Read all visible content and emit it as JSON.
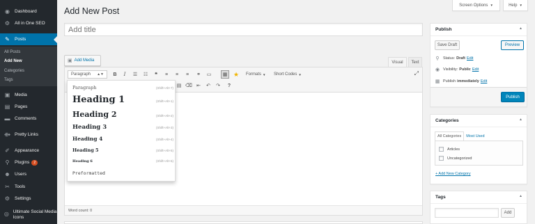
{
  "sidebar": {
    "items": [
      {
        "label": "Dashboard",
        "icon": "dashboard-icon",
        "glyph": "◉"
      },
      {
        "label": "All in One SEO",
        "icon": "seo-gear-icon",
        "glyph": "⚙"
      },
      {
        "label": "Posts",
        "icon": "pushpin-icon",
        "glyph": "✎"
      },
      {
        "label": "Media",
        "icon": "media-icon",
        "glyph": "▣"
      },
      {
        "label": "Pages",
        "icon": "pages-icon",
        "glyph": "▤"
      },
      {
        "label": "Comments",
        "icon": "comment-icon",
        "glyph": "▬"
      },
      {
        "label": "Pretty Links",
        "icon": "pretty-links-icon",
        "glyph": "⟴"
      },
      {
        "label": "Appearance",
        "icon": "appearance-brush-icon",
        "glyph": "✐"
      },
      {
        "label": "Plugins",
        "icon": "plugins-icon",
        "glyph": "⚲",
        "badge": "2"
      },
      {
        "label": "Users",
        "icon": "users-icon",
        "glyph": "☻"
      },
      {
        "label": "Tools",
        "icon": "tools-wrench-icon",
        "glyph": "✂"
      },
      {
        "label": "Settings",
        "icon": "settings-icon",
        "glyph": "⚙"
      },
      {
        "label": "Ultimate Social Media Icons",
        "icon": "social-media-icon",
        "glyph": "◎"
      }
    ],
    "submenu": [
      "All Posts",
      "Add New",
      "Categories",
      "Tags"
    ]
  },
  "header": {
    "screen_options": "Screen Options",
    "help": "Help",
    "caret": "▼"
  },
  "page_title": "Add New Post",
  "title_placeholder": "Add title",
  "add_media": "Add Media",
  "editor": {
    "tab_visual": "Visual",
    "tab_text": "Text",
    "format_value": "Paragraph",
    "formats": "Formats",
    "shortcodes": "Short Codes",
    "word_count": "Word count: 0"
  },
  "format_menu": [
    {
      "label": "Paragraph",
      "shortcut": "(Shift+Alt+7)"
    },
    {
      "label": "Heading 1",
      "shortcut": "(Shift+Alt+1)"
    },
    {
      "label": "Heading 2",
      "shortcut": "(Shift+Alt+2)"
    },
    {
      "label": "Heading 3",
      "shortcut": "(Shift+Alt+3)"
    },
    {
      "label": "Heading 4",
      "shortcut": "(Shift+Alt+4)"
    },
    {
      "label": "Heading 5",
      "shortcut": "(Shift+Alt+5)"
    },
    {
      "label": "Heading 6",
      "shortcut": "(Shift+Alt+6)"
    },
    {
      "label": "Preformatted",
      "shortcut": ""
    }
  ],
  "publish": {
    "title": "Publish",
    "save_draft": "Save Draft",
    "preview": "Preview",
    "status_label": "Status:",
    "status_value": "Draft",
    "visibility_label": "Visibility:",
    "visibility_value": "Public",
    "publish_label": "Publish",
    "publish_value": "immediately",
    "edit": "Edit",
    "publish_button": "Publish"
  },
  "categories": {
    "title": "Categories",
    "tab_all": "All Categories",
    "tab_most_used": "Most Used",
    "items": [
      "Articles",
      "Uncategorized"
    ],
    "add_new": "+ Add New Category"
  },
  "tags": {
    "title": "Tags",
    "add": "Add"
  },
  "colors": {
    "admin_sidebar": "#23282d",
    "accent": "#0073aa",
    "primary_button": "#0085ba",
    "plugin_badge": "#d54e21"
  }
}
